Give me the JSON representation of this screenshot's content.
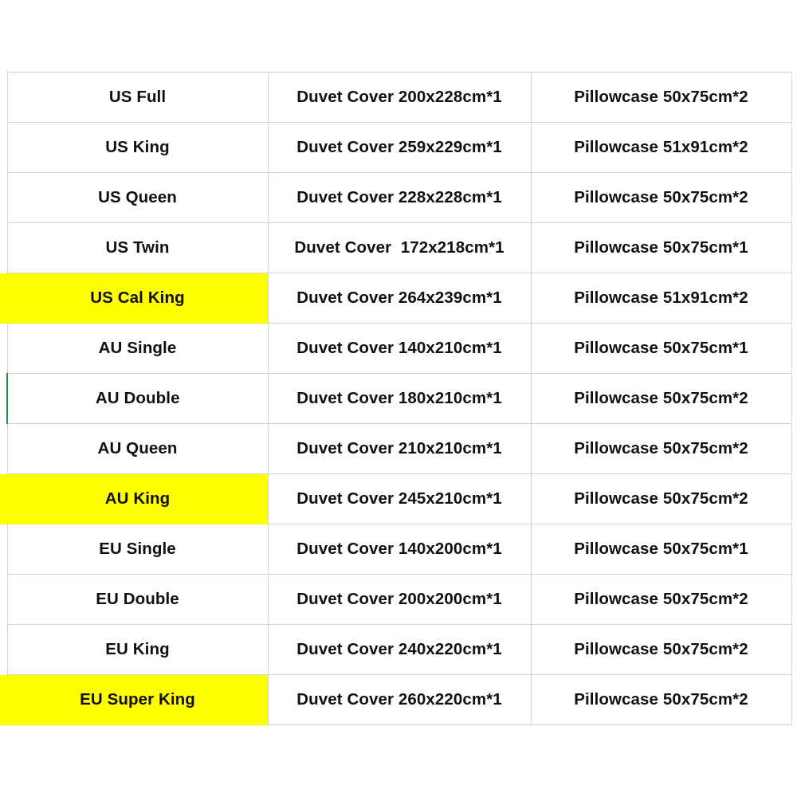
{
  "table": {
    "name": "bedding-size-chart",
    "colors": {
      "highlight": "#ffff00",
      "grid_line": "#d4d4d4",
      "text": "#101010",
      "marker": "#2e8b36"
    },
    "columns": [
      "size",
      "duvet",
      "pillow"
    ],
    "rows": [
      {
        "size": "US Full",
        "duvet": "Duvet Cover 200x228cm*1",
        "pillow": "Pillowcase 50x75cm*2",
        "highlight": false,
        "marked": false
      },
      {
        "size": "US King",
        "duvet": "Duvet Cover 259x229cm*1",
        "pillow": "Pillowcase 51x91cm*2",
        "highlight": false,
        "marked": false
      },
      {
        "size": "US Queen",
        "duvet": "Duvet Cover 228x228cm*1",
        "pillow": "Pillowcase 50x75cm*2",
        "highlight": false,
        "marked": false
      },
      {
        "size": "US Twin",
        "duvet": "Duvet Cover  172x218cm*1",
        "pillow": "Pillowcase 50x75cm*1",
        "highlight": false,
        "marked": false
      },
      {
        "size": "US Cal King",
        "duvet": "Duvet Cover 264x239cm*1",
        "pillow": "Pillowcase 51x91cm*2",
        "highlight": true,
        "marked": false
      },
      {
        "size": "AU Single",
        "duvet": "Duvet Cover 140x210cm*1",
        "pillow": "Pillowcase 50x75cm*1",
        "highlight": false,
        "marked": false
      },
      {
        "size": "AU Double",
        "duvet": "Duvet Cover 180x210cm*1",
        "pillow": "Pillowcase 50x75cm*2",
        "highlight": false,
        "marked": true
      },
      {
        "size": "AU Queen",
        "duvet": "Duvet Cover 210x210cm*1",
        "pillow": "Pillowcase 50x75cm*2",
        "highlight": false,
        "marked": false
      },
      {
        "size": "AU King",
        "duvet": "Duvet Cover 245x210cm*1",
        "pillow": "Pillowcase 50x75cm*2",
        "highlight": true,
        "marked": false
      },
      {
        "size": "EU Single",
        "duvet": "Duvet Cover 140x200cm*1",
        "pillow": "Pillowcase 50x75cm*1",
        "highlight": false,
        "marked": false
      },
      {
        "size": "EU Double",
        "duvet": "Duvet Cover 200x200cm*1",
        "pillow": "Pillowcase 50x75cm*2",
        "highlight": false,
        "marked": false
      },
      {
        "size": "EU King",
        "duvet": "Duvet Cover 240x220cm*1",
        "pillow": "Pillowcase 50x75cm*2",
        "highlight": false,
        "marked": false
      },
      {
        "size": "EU Super King",
        "duvet": "Duvet Cover 260x220cm*1",
        "pillow": "Pillowcase 50x75cm*2",
        "highlight": true,
        "marked": false
      }
    ]
  }
}
